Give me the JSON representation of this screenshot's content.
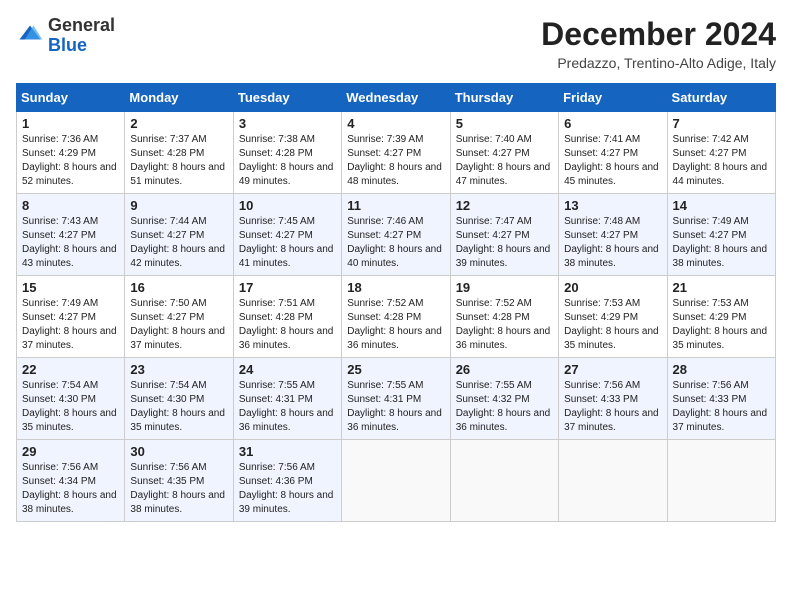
{
  "header": {
    "logo": {
      "general": "General",
      "blue": "Blue"
    },
    "title": "December 2024",
    "location": "Predazzo, Trentino-Alto Adige, Italy"
  },
  "calendar": {
    "weekdays": [
      "Sunday",
      "Monday",
      "Tuesday",
      "Wednesday",
      "Thursday",
      "Friday",
      "Saturday"
    ],
    "weeks": [
      [
        {
          "day": "1",
          "sunrise": "Sunrise: 7:36 AM",
          "sunset": "Sunset: 4:29 PM",
          "daylight": "Daylight: 8 hours and 52 minutes."
        },
        {
          "day": "2",
          "sunrise": "Sunrise: 7:37 AM",
          "sunset": "Sunset: 4:28 PM",
          "daylight": "Daylight: 8 hours and 51 minutes."
        },
        {
          "day": "3",
          "sunrise": "Sunrise: 7:38 AM",
          "sunset": "Sunset: 4:28 PM",
          "daylight": "Daylight: 8 hours and 49 minutes."
        },
        {
          "day": "4",
          "sunrise": "Sunrise: 7:39 AM",
          "sunset": "Sunset: 4:27 PM",
          "daylight": "Daylight: 8 hours and 48 minutes."
        },
        {
          "day": "5",
          "sunrise": "Sunrise: 7:40 AM",
          "sunset": "Sunset: 4:27 PM",
          "daylight": "Daylight: 8 hours and 47 minutes."
        },
        {
          "day": "6",
          "sunrise": "Sunrise: 7:41 AM",
          "sunset": "Sunset: 4:27 PM",
          "daylight": "Daylight: 8 hours and 45 minutes."
        },
        {
          "day": "7",
          "sunrise": "Sunrise: 7:42 AM",
          "sunset": "Sunset: 4:27 PM",
          "daylight": "Daylight: 8 hours and 44 minutes."
        }
      ],
      [
        {
          "day": "8",
          "sunrise": "Sunrise: 7:43 AM",
          "sunset": "Sunset: 4:27 PM",
          "daylight": "Daylight: 8 hours and 43 minutes."
        },
        {
          "day": "9",
          "sunrise": "Sunrise: 7:44 AM",
          "sunset": "Sunset: 4:27 PM",
          "daylight": "Daylight: 8 hours and 42 minutes."
        },
        {
          "day": "10",
          "sunrise": "Sunrise: 7:45 AM",
          "sunset": "Sunset: 4:27 PM",
          "daylight": "Daylight: 8 hours and 41 minutes."
        },
        {
          "day": "11",
          "sunrise": "Sunrise: 7:46 AM",
          "sunset": "Sunset: 4:27 PM",
          "daylight": "Daylight: 8 hours and 40 minutes."
        },
        {
          "day": "12",
          "sunrise": "Sunrise: 7:47 AM",
          "sunset": "Sunset: 4:27 PM",
          "daylight": "Daylight: 8 hours and 39 minutes."
        },
        {
          "day": "13",
          "sunrise": "Sunrise: 7:48 AM",
          "sunset": "Sunset: 4:27 PM",
          "daylight": "Daylight: 8 hours and 38 minutes."
        },
        {
          "day": "14",
          "sunrise": "Sunrise: 7:49 AM",
          "sunset": "Sunset: 4:27 PM",
          "daylight": "Daylight: 8 hours and 38 minutes."
        }
      ],
      [
        {
          "day": "15",
          "sunrise": "Sunrise: 7:49 AM",
          "sunset": "Sunset: 4:27 PM",
          "daylight": "Daylight: 8 hours and 37 minutes."
        },
        {
          "day": "16",
          "sunrise": "Sunrise: 7:50 AM",
          "sunset": "Sunset: 4:27 PM",
          "daylight": "Daylight: 8 hours and 37 minutes."
        },
        {
          "day": "17",
          "sunrise": "Sunrise: 7:51 AM",
          "sunset": "Sunset: 4:28 PM",
          "daylight": "Daylight: 8 hours and 36 minutes."
        },
        {
          "day": "18",
          "sunrise": "Sunrise: 7:52 AM",
          "sunset": "Sunset: 4:28 PM",
          "daylight": "Daylight: 8 hours and 36 minutes."
        },
        {
          "day": "19",
          "sunrise": "Sunrise: 7:52 AM",
          "sunset": "Sunset: 4:28 PM",
          "daylight": "Daylight: 8 hours and 36 minutes."
        },
        {
          "day": "20",
          "sunrise": "Sunrise: 7:53 AM",
          "sunset": "Sunset: 4:29 PM",
          "daylight": "Daylight: 8 hours and 35 minutes."
        },
        {
          "day": "21",
          "sunrise": "Sunrise: 7:53 AM",
          "sunset": "Sunset: 4:29 PM",
          "daylight": "Daylight: 8 hours and 35 minutes."
        }
      ],
      [
        {
          "day": "22",
          "sunrise": "Sunrise: 7:54 AM",
          "sunset": "Sunset: 4:30 PM",
          "daylight": "Daylight: 8 hours and 35 minutes."
        },
        {
          "day": "23",
          "sunrise": "Sunrise: 7:54 AM",
          "sunset": "Sunset: 4:30 PM",
          "daylight": "Daylight: 8 hours and 35 minutes."
        },
        {
          "day": "24",
          "sunrise": "Sunrise: 7:55 AM",
          "sunset": "Sunset: 4:31 PM",
          "daylight": "Daylight: 8 hours and 36 minutes."
        },
        {
          "day": "25",
          "sunrise": "Sunrise: 7:55 AM",
          "sunset": "Sunset: 4:31 PM",
          "daylight": "Daylight: 8 hours and 36 minutes."
        },
        {
          "day": "26",
          "sunrise": "Sunrise: 7:55 AM",
          "sunset": "Sunset: 4:32 PM",
          "daylight": "Daylight: 8 hours and 36 minutes."
        },
        {
          "day": "27",
          "sunrise": "Sunrise: 7:56 AM",
          "sunset": "Sunset: 4:33 PM",
          "daylight": "Daylight: 8 hours and 37 minutes."
        },
        {
          "day": "28",
          "sunrise": "Sunrise: 7:56 AM",
          "sunset": "Sunset: 4:33 PM",
          "daylight": "Daylight: 8 hours and 37 minutes."
        }
      ],
      [
        {
          "day": "29",
          "sunrise": "Sunrise: 7:56 AM",
          "sunset": "Sunset: 4:34 PM",
          "daylight": "Daylight: 8 hours and 38 minutes."
        },
        {
          "day": "30",
          "sunrise": "Sunrise: 7:56 AM",
          "sunset": "Sunset: 4:35 PM",
          "daylight": "Daylight: 8 hours and 38 minutes."
        },
        {
          "day": "31",
          "sunrise": "Sunrise: 7:56 AM",
          "sunset": "Sunset: 4:36 PM",
          "daylight": "Daylight: 8 hours and 39 minutes."
        },
        null,
        null,
        null,
        null
      ]
    ]
  }
}
